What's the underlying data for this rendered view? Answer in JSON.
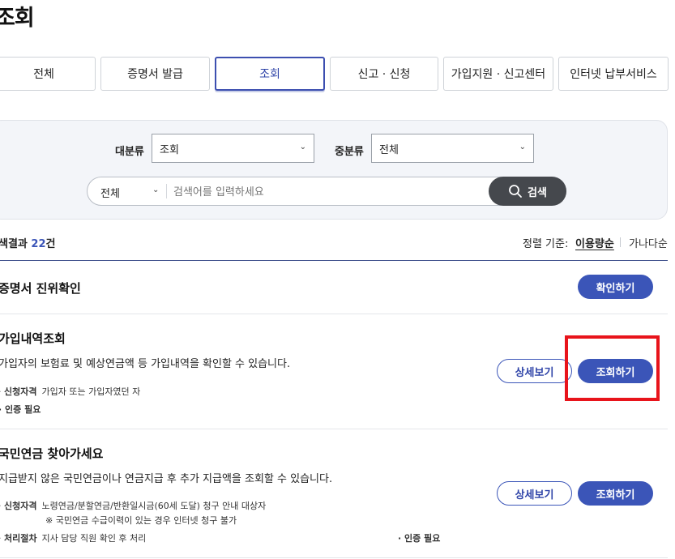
{
  "page": {
    "title": "조회"
  },
  "tabs": [
    {
      "label": "전체",
      "active": false
    },
    {
      "label": "증명서 발급",
      "active": false
    },
    {
      "label": "조회",
      "active": true
    },
    {
      "label": "신고 · 신청",
      "active": false
    },
    {
      "label": "가입지원 · 신고센터",
      "active": false
    },
    {
      "label": "인터넷 납부서비스",
      "active": false
    }
  ],
  "filter": {
    "major_label": "대분류",
    "major_value": "조회",
    "minor_label": "중분류",
    "minor_value": "전체",
    "scope_value": "전체",
    "search_placeholder": "검색어를 입력하세요",
    "search_button": "검색"
  },
  "results": {
    "prefix": "색결과",
    "count": "22",
    "suffix": "건",
    "sort_label": "정렬 기준:",
    "sort_options": [
      "이용량순",
      "가나다순"
    ],
    "sort_active": "이용량순"
  },
  "items": [
    {
      "title": "증명서 진위확인",
      "action": "확인하기"
    },
    {
      "title": "가입내역조회",
      "desc": "가입자의 보험료 및 예상연금액 등 가입내역을 확인할 수 있습니다.",
      "eligibility_label": "신청자격",
      "eligibility": "가입자 또는 가입자였던 자",
      "auth": "인증 필요",
      "detail": "상세보기",
      "action": "조회하기"
    },
    {
      "title": "국민연금 찾아가세요",
      "desc": "지급받지 않은 국민연금이나 연금지급 후 추가 지급액을 조회할 수 있습니다.",
      "eligibility_label": "신청자격",
      "eligibility": "노령연금/분할연금/반환일시금(60세 도달) 청구 안내 대상자",
      "note": "※ 국민연금 수급이력이 있는 경우 인터넷 청구 불가",
      "process_label": "처리절차",
      "process": "지사 담당 직원 확인 후 처리",
      "auth": "인증 필요",
      "detail": "상세보기",
      "action": "조회하기"
    }
  ],
  "colors": {
    "accent": "#3b55b8",
    "highlight": "#e8141b",
    "search_button": "#45484d"
  }
}
